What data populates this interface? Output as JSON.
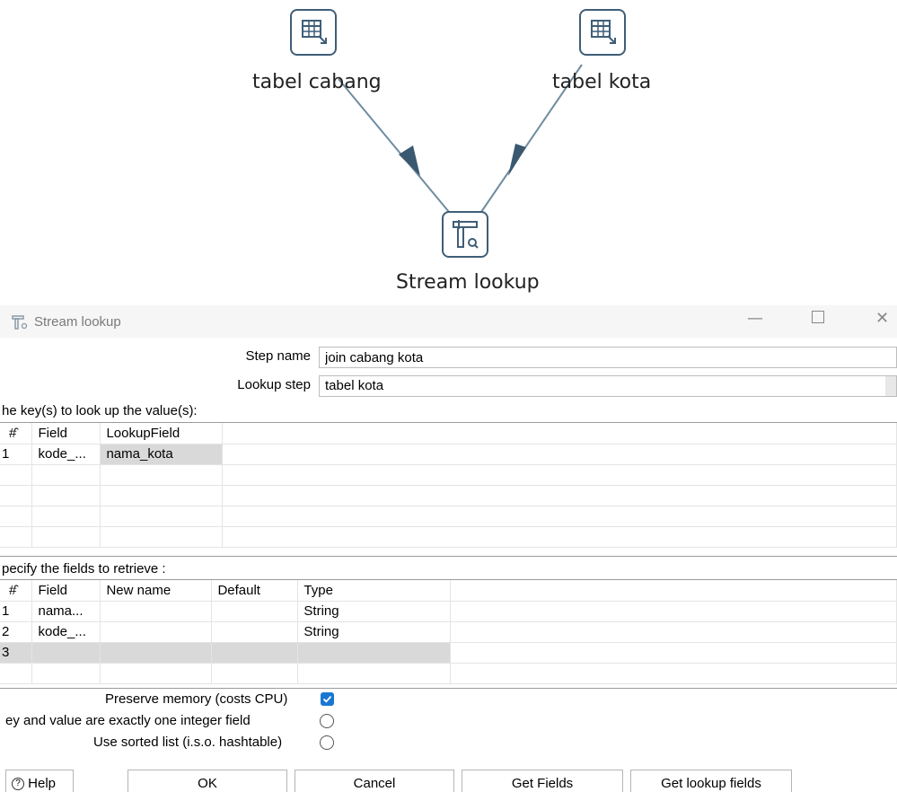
{
  "canvas": {
    "steps": [
      {
        "label": "tabel cabang",
        "icon": "table-input-icon"
      },
      {
        "label": "tabel kota",
        "icon": "table-input-icon"
      },
      {
        "label": "Stream lookup",
        "icon": "stream-lookup-icon"
      }
    ],
    "colors": {
      "hop": "#6f8ca0",
      "arrow": "#3a5870",
      "icon_border": "#3f5e78"
    }
  },
  "dialog": {
    "title": "Stream lookup",
    "step_name_label": "Step name",
    "step_name_value": "join cabang kota",
    "lookup_step_label": "Lookup step",
    "lookup_step_value": "tabel kota",
    "keys_section_label": "he key(s) to look up the value(s):",
    "keys_table": {
      "headers": [
        "#",
        "Field",
        "LookupField"
      ],
      "rows": [
        [
          "1",
          "kode_...",
          "nama_kota"
        ]
      ]
    },
    "retrieve_section_label": "pecify the fields to retrieve :",
    "retrieve_table": {
      "headers": [
        "#",
        "Field",
        "New name",
        "Default",
        "Type"
      ],
      "rows": [
        [
          "1",
          "nama...",
          "",
          "",
          "String"
        ],
        [
          "2",
          "kode_...",
          "",
          "",
          "String"
        ],
        [
          "3",
          "",
          "",
          "",
          ""
        ]
      ]
    },
    "options": {
      "preserve_memory": {
        "label": "Preserve memory (costs CPU)",
        "checked": true
      },
      "integer_field": {
        "label": "ey and value are exactly one integer field",
        "checked": false
      },
      "sorted_list": {
        "label": "Use sorted list (i.s.o. hashtable)",
        "checked": false
      }
    },
    "buttons": {
      "help": "Help",
      "ok": "OK",
      "cancel": "Cancel",
      "get_fields": "Get Fields",
      "get_lookup_fields": "Get lookup fields"
    },
    "colors": {
      "checkbox": "#1976d2",
      "selected_row": "#d9d9d9"
    }
  }
}
